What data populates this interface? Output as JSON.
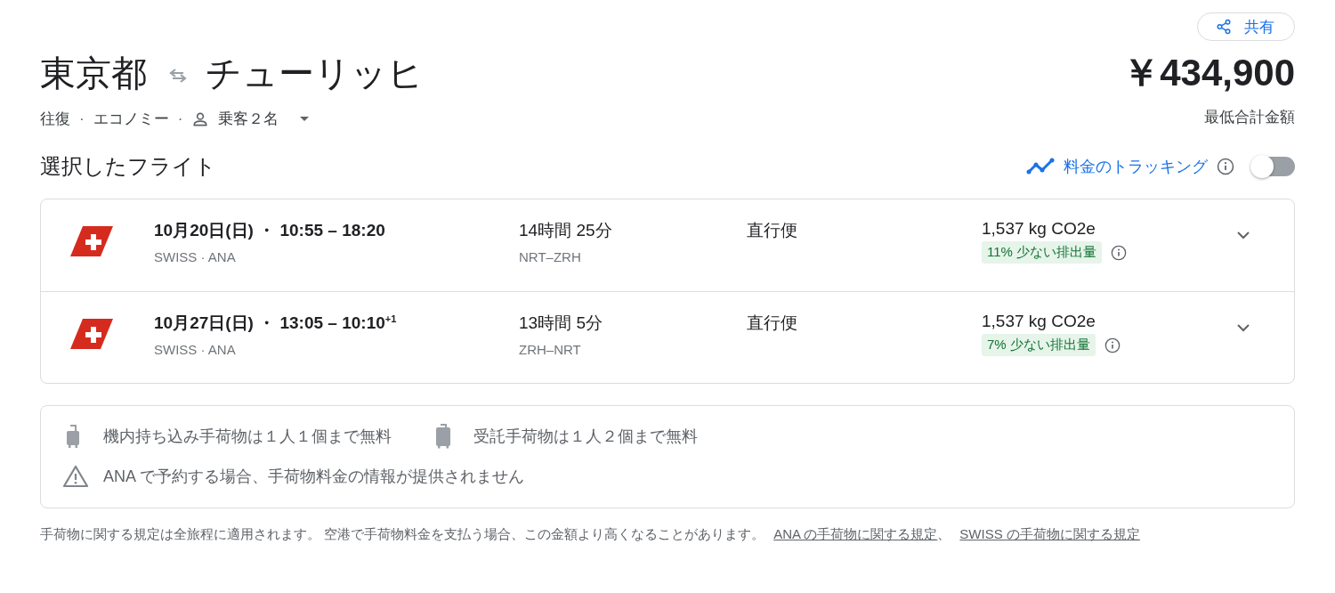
{
  "share_button": {
    "label": "共有"
  },
  "title": {
    "origin": "東京都",
    "destination": "チューリッヒ"
  },
  "price": {
    "amount": "￥434,900",
    "caption": "最低合計金額"
  },
  "trip_option_separator": "·",
  "trip_options": [
    {
      "kind": "text",
      "label": "往復"
    },
    {
      "kind": "text",
      "label": "エコノミー"
    },
    {
      "kind": "passengers",
      "label": "乗客２名"
    }
  ],
  "section_heading": "選択したフライト",
  "price_tracking": {
    "label": "料金のトラッキング",
    "on": false
  },
  "flights": [
    {
      "date_time": "10月20日(日) ・ 10:55 – 18:20",
      "airlines": "SWISS · ANA",
      "duration": "14時間 25分",
      "route": "NRT–ZRH",
      "stops": "直行便",
      "emissions": "1,537 kg CO2e",
      "emissions_badge": "11% 少ない排出量",
      "expanded": false
    },
    {
      "date_time": "10月27日(日) ・ 13:05 – 10:10$^{+1}$",
      "airlines": "SWISS · ANA",
      "duration": "13時間 5分",
      "route": "ZRH–NRT",
      "stops": "直行便",
      "emissions": "1,537 kg CO2e",
      "emissions_badge": "7% 少ない排出量",
      "expanded": false
    }
  ],
  "baggage": {
    "items": [
      {
        "kind": "carry_on",
        "text": "機内持ち込み手荷物は１人１個まで無料"
      },
      {
        "kind": "checked",
        "text": "受託手荷物は１人２個まで無料"
      }
    ],
    "warning": "ANA で予約する場合、手荷物料金の情報が提供されません"
  },
  "footer": {
    "note": "手荷物に関する規定は全旅程に適用されます。 空港で手荷物料金を支払う場合、この金額より高くなることがあります。",
    "links": [
      "ANA の手荷物に関する規定",
      "SWISS の手荷物に関する規定"
    ],
    "separator": "、"
  }
}
